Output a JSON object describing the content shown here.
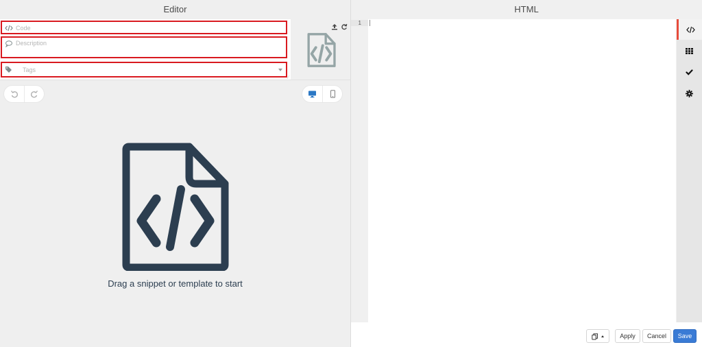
{
  "left_panel": {
    "title": "Editor",
    "fields": {
      "code_placeholder": "Code",
      "description_placeholder": "Description",
      "tags_placeholder": "Tags"
    },
    "empty_state": "Drag a snippet or template to start"
  },
  "right_panel": {
    "title": "HTML",
    "line_numbers": [
      "1"
    ],
    "side_tabs": [
      {
        "icon": "code-icon",
        "active": true
      },
      {
        "icon": "grid-icon",
        "active": false
      },
      {
        "icon": "check-icon",
        "active": false
      },
      {
        "icon": "gear-icon",
        "active": false
      }
    ],
    "footer": {
      "apply_label": "Apply",
      "cancel_label": "Cancel",
      "save_label": "Save"
    }
  },
  "colors": {
    "accent_red": "#d9191f",
    "save_blue": "#3a7bd5",
    "icon_dark": "#2c3e50"
  }
}
